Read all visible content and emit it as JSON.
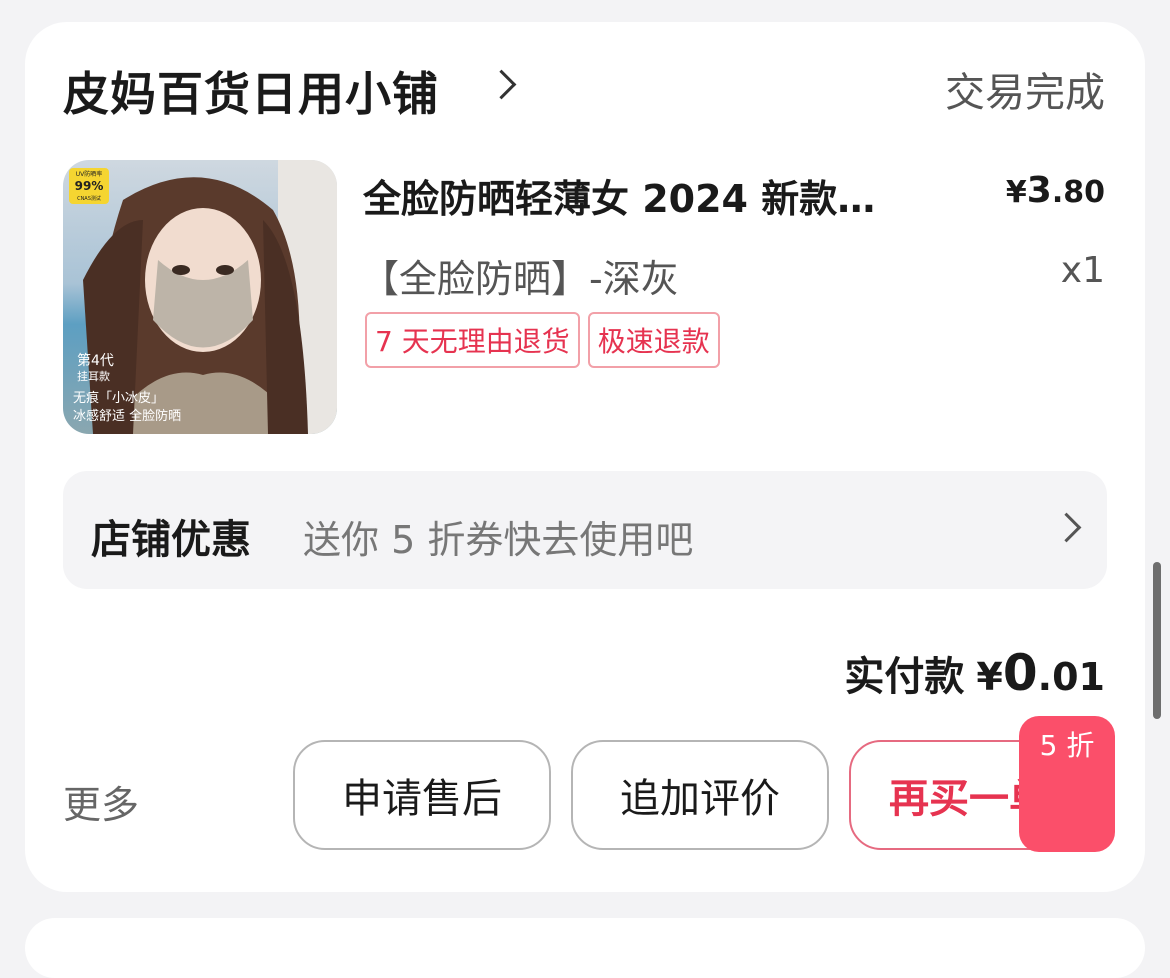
{
  "shop": {
    "name": "皮妈百货日用小铺",
    "status": "交易完成"
  },
  "product": {
    "title": "全脸防晒轻薄女 2024 新款…",
    "price_currency": "¥",
    "price_int": "3",
    "price_dec": ".80",
    "variant": "【全脸防晒】-深灰",
    "quantity": "x1",
    "tags": [
      "7 天无理由退货",
      "极速退款"
    ],
    "image": {
      "badge_top": "UV防晒率",
      "badge_pct": "99%",
      "badge_bottom": "CNAS测试",
      "caption_gen": "第4代",
      "caption_ear": "挂耳款",
      "caption_line1": "无痕「小冰皮」",
      "caption_line2": "冰感舒适 全脸防晒"
    }
  },
  "promo": {
    "label": "店铺优惠",
    "text": "送你 5 折券快去使用吧"
  },
  "payment": {
    "label": "实付款",
    "currency": "¥",
    "amount_int": "0",
    "amount_dec": ".01"
  },
  "actions": {
    "more": "更多",
    "after_sale": "申请售后",
    "add_review": "追加评价",
    "rebuy": "再买一单",
    "discount_badge": "5 折"
  },
  "colors": {
    "accent": "#fb4f6a",
    "tag_red": "#e63350",
    "promo_bg": "#f4f4f6"
  }
}
